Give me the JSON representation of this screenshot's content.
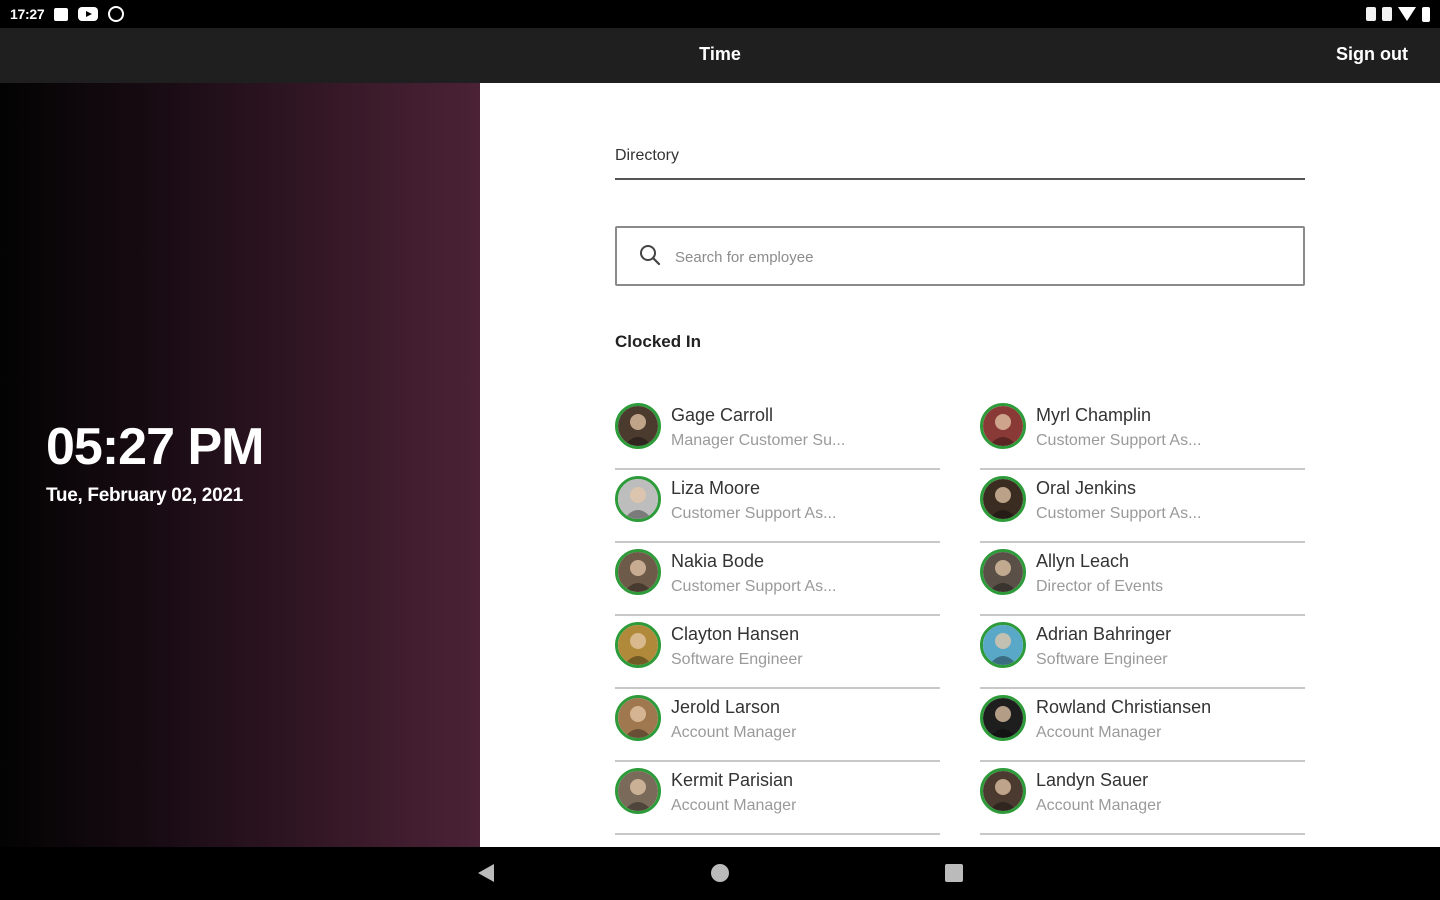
{
  "status_bar": {
    "time": "17:27"
  },
  "app_bar": {
    "title": "Time",
    "sign_out_label": "Sign out"
  },
  "clock": {
    "time": "05:27 PM",
    "date": "Tue, February 02, 2021"
  },
  "directory": {
    "label": "Directory",
    "search_placeholder": "Search for employee",
    "section_title": "Clocked In"
  },
  "employees": [
    {
      "name": "Gage Carroll",
      "role": "Manager Customer Su...",
      "avatar_color": "#4b3a2e"
    },
    {
      "name": "Myrl Champlin",
      "role": "Customer Support As...",
      "avatar_color": "#8a3a36"
    },
    {
      "name": "Liza Moore",
      "role": "Customer Support As...",
      "avatar_color": "#bdbdbd"
    },
    {
      "name": "Oral Jenkins",
      "role": "Customer Support As...",
      "avatar_color": "#3b2c22"
    },
    {
      "name": "Nakia Bode",
      "role": "Customer Support As...",
      "avatar_color": "#6e5a48"
    },
    {
      "name": "Allyn Leach",
      "role": "Director of Events",
      "avatar_color": "#5a5048"
    },
    {
      "name": "Clayton Hansen",
      "role": "Software Engineer",
      "avatar_color": "#b08a3a"
    },
    {
      "name": "Adrian Bahringer",
      "role": "Software Engineer",
      "avatar_color": "#5aa8c8"
    },
    {
      "name": "Jerold Larson",
      "role": "Account Manager",
      "avatar_color": "#a07850"
    },
    {
      "name": "Rowland Christiansen",
      "role": "Account Manager",
      "avatar_color": "#1e1e1e"
    },
    {
      "name": "Kermit Parisian",
      "role": "Account Manager",
      "avatar_color": "#7a6a5a"
    },
    {
      "name": "Landyn Sauer",
      "role": "Account Manager",
      "avatar_color": "#4a3a30"
    }
  ]
}
